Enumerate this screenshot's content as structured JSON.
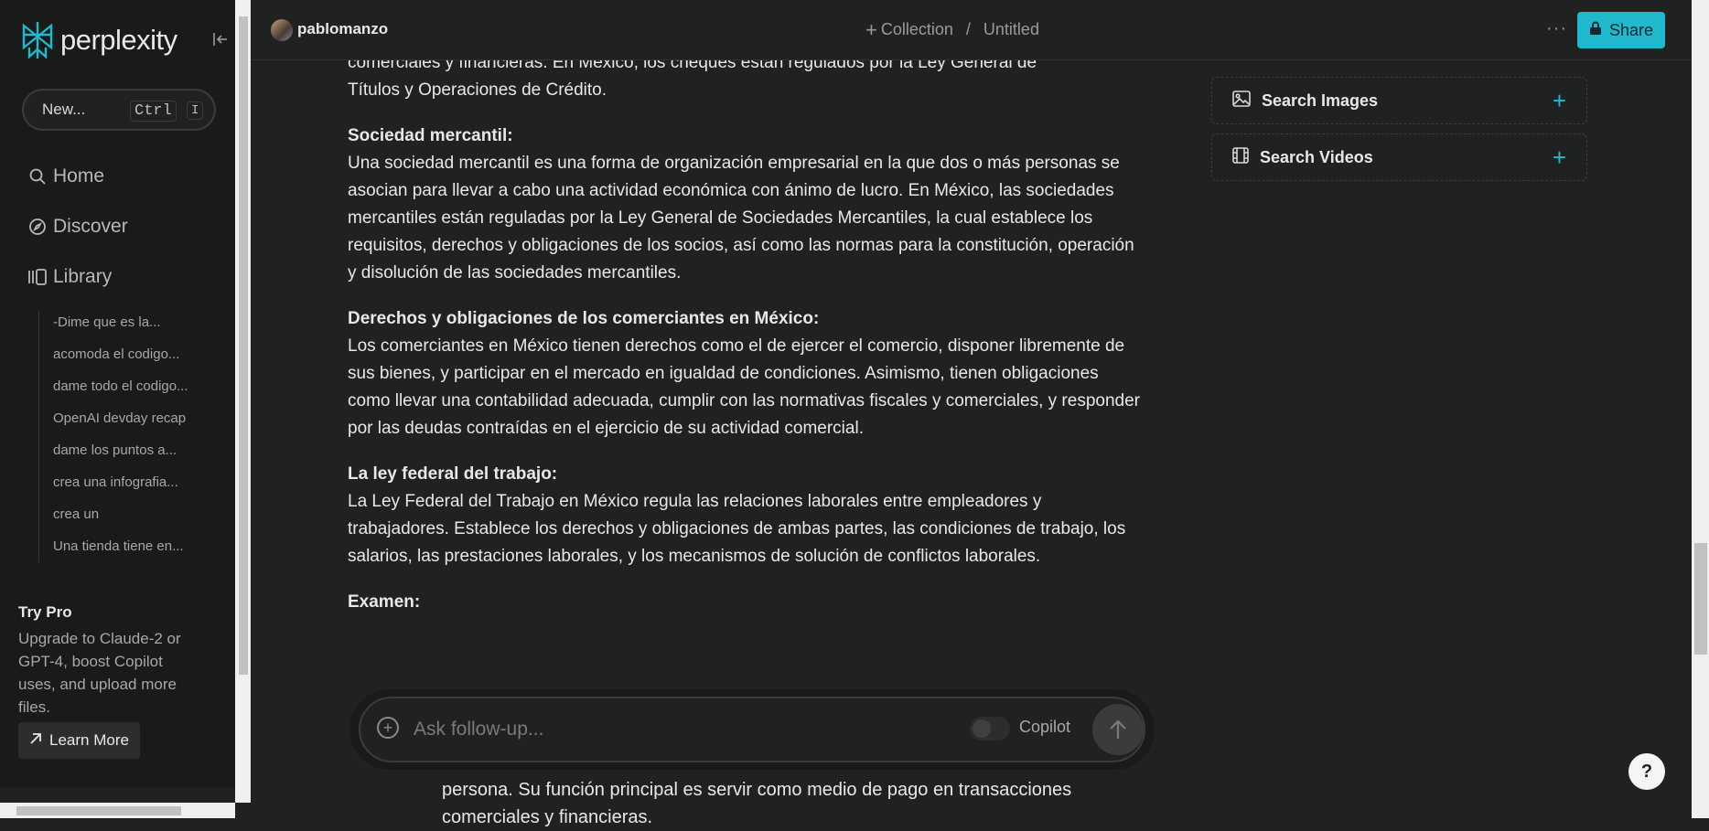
{
  "sidebar": {
    "logo_text": "perplexity",
    "new_label": "New...",
    "kbd_ctrl": "Ctrl",
    "kbd_key": "I",
    "nav": {
      "home": "Home",
      "discover": "Discover",
      "library": "Library"
    },
    "threads": [
      "-Dime que es la...",
      "acomoda el codigo...",
      "dame todo el codigo...",
      "OpenAI devday recap",
      "dame los puntos a...",
      "crea una infografia...",
      "crea un",
      "Una tienda tiene en..."
    ],
    "try_pro": {
      "title": "Try Pro",
      "body": "Upgrade to Claude-2 or GPT-4, boost Copilot uses, and upload more files.",
      "learn_more": "Learn More"
    }
  },
  "header": {
    "username": "pablomanzo",
    "collection": "Collection",
    "separator": "/",
    "thread_title": "Untitled",
    "more": "···",
    "share": "Share"
  },
  "content": {
    "intro_line1": "comerciales y financieras. En México, los cheques están regulados por la Ley General de",
    "intro_line2": "Títulos y Operaciones de Crédito.",
    "sections": [
      {
        "heading": "Sociedad mercantil:",
        "body": "Una sociedad mercantil es una forma de organización empresarial en la que dos o más personas se asocian para llevar a cabo una actividad económica con ánimo de lucro. En México, las sociedades mercantiles están reguladas por la Ley General de Sociedades Mercantiles, la cual establece los requisitos, derechos y obligaciones de los socios, así como las normas para la constitución, operación y disolución de las sociedades mercantiles."
      },
      {
        "heading": "Derechos y obligaciones de los comerciantes en México:",
        "body": "Los comerciantes en México tienen derechos como el de ejercer el comercio, disponer libremente de sus bienes, y participar en el mercado en igualdad de condiciones. Asimismo, tienen obligaciones como llevar una contabilidad adecuada, cumplir con las normativas fiscales y comerciales, y responder por las deudas contraídas en el ejercicio de su actividad comercial."
      },
      {
        "heading": "La ley federal del trabajo:",
        "body": "La Ley Federal del Trabajo en México regula las relaciones laborales entre empleadores y trabajadores. Establece los derechos y obligaciones de ambas partes, las condiciones de trabajo, los salarios, las prestaciones laborales, y los mecanismos de solución de conflictos laborales."
      }
    ],
    "exam_heading": "Examen:",
    "bottom_line1": "persona. Su función principal es servir como medio de pago en transacciones",
    "bottom_line2": "comerciales y financieras."
  },
  "right_panel": {
    "search_images": "Search Images",
    "search_videos": "Search Videos"
  },
  "ask": {
    "placeholder": "Ask follow-up...",
    "copilot": "Copilot"
  },
  "help": "?",
  "colors": {
    "accent": "#20b8cd",
    "background": "#202222",
    "sidebar": "#191a1a"
  }
}
